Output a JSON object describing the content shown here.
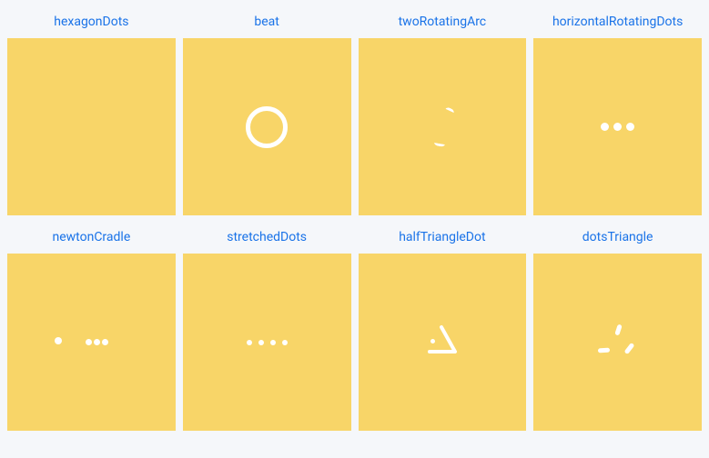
{
  "loaders": {
    "row1": [
      {
        "name": "hexagonDots"
      },
      {
        "name": "beat"
      },
      {
        "name": "twoRotatingArc"
      },
      {
        "name": "horizontalRotatingDots"
      }
    ],
    "row2": [
      {
        "name": "newtonCradle"
      },
      {
        "name": "stretchedDots"
      },
      {
        "name": "halfTriangleDot"
      },
      {
        "name": "dotsTriangle"
      }
    ]
  },
  "colors": {
    "preview_bg": "#f8d568",
    "link": "#1a73e8",
    "shape": "#ffffff",
    "page_bg": "#f5f7fa"
  }
}
